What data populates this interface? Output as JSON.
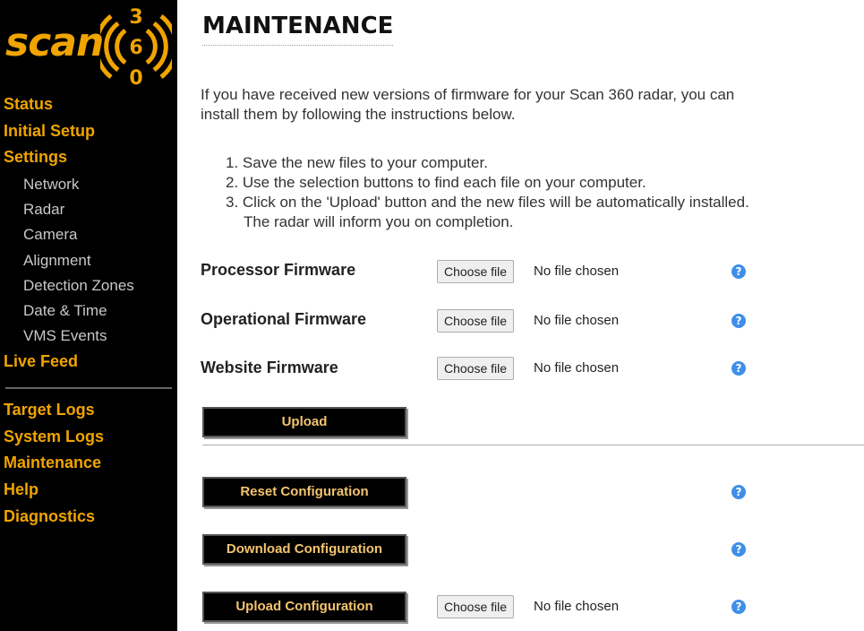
{
  "brand": {
    "logo_text": "scan",
    "digits": [
      "3",
      "6",
      "0"
    ]
  },
  "sidebar": {
    "items": [
      {
        "label": "Status",
        "type": "main"
      },
      {
        "label": "Initial Setup",
        "type": "main"
      },
      {
        "label": "Settings",
        "type": "main"
      },
      {
        "label": "Network",
        "type": "sub"
      },
      {
        "label": "Radar",
        "type": "sub"
      },
      {
        "label": "Camera",
        "type": "sub"
      },
      {
        "label": "Alignment",
        "type": "sub"
      },
      {
        "label": "Detection Zones",
        "type": "sub"
      },
      {
        "label": "Date & Time",
        "type": "sub"
      },
      {
        "label": "VMS Events",
        "type": "sub"
      },
      {
        "label": "Live Feed",
        "type": "main"
      },
      {
        "label": "Target Logs",
        "type": "main"
      },
      {
        "label": "System Logs",
        "type": "main"
      },
      {
        "label": "Maintenance",
        "type": "main"
      },
      {
        "label": "Help",
        "type": "main"
      },
      {
        "label": "Diagnostics",
        "type": "main"
      }
    ]
  },
  "main": {
    "title": "MAINTENANCE",
    "intro_line1": "If you have received new versions of firmware for your Scan 360 radar, you can",
    "intro_line2": "install them by following the instructions below.",
    "steps": [
      "1. Save the new files to your computer.",
      "2. Use the selection buttons to find each file on your computer.",
      "3. Click on the 'Upload' button and the new files will be automatically installed.",
      "The radar will inform you on completion."
    ],
    "firmware": [
      {
        "label": "Processor Firmware",
        "button": "Choose file",
        "status": "No file chosen"
      },
      {
        "label": "Operational Firmware",
        "button": "Choose file",
        "status": "No file chosen"
      },
      {
        "label": "Website Firmware",
        "button": "Choose file",
        "status": "No file chosen"
      }
    ],
    "upload_label": "Upload",
    "reset_label": "Reset Configuration",
    "download_label": "Download Configuration",
    "upload_config_label": "Upload Configuration",
    "upload_config_file": {
      "button": "Choose file",
      "status": "No file chosen"
    },
    "help_glyph": "?"
  },
  "colors": {
    "sidebar_bg": "#000000",
    "accent": "#f0a400",
    "button_text": "#f3c46e",
    "help_blue": "#3f8fe8"
  }
}
